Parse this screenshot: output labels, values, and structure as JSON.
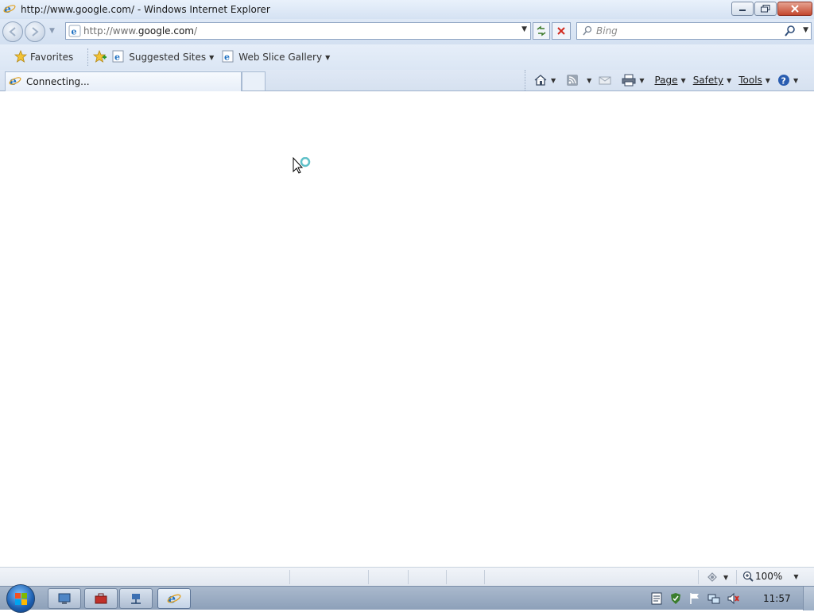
{
  "window": {
    "title": "http://www.google.com/ - Windows Internet Explorer"
  },
  "address": {
    "url_prefix": "http://www.",
    "url_domain": "google.com",
    "url_suffix": "/"
  },
  "search": {
    "placeholder": "Bing"
  },
  "favorites_bar": {
    "favorites_label": "Favorites",
    "suggested_sites_label": "Suggested Sites",
    "web_slice_gallery_label": "Web Slice Gallery"
  },
  "tabs": [
    {
      "label": "Connecting..."
    }
  ],
  "command_bar": {
    "page_label": "Page",
    "safety_label": "Safety",
    "tools_label": "Tools"
  },
  "status_bar": {
    "zoom": "100%"
  },
  "taskbar": {
    "clock": "11:57"
  },
  "icons": [
    "ie-icon",
    "back-icon",
    "forward-icon",
    "refresh-icon",
    "stop-icon",
    "search-icon",
    "favorites-star-icon",
    "add-favorites-icon",
    "home-icon",
    "feeds-icon",
    "mail-icon",
    "print-icon",
    "help-icon",
    "zoom-icon",
    "busy-cursor-icon",
    "windows-orb-icon"
  ],
  "colors": {
    "chrome_blue": "#d5e2f3",
    "close_red": "#c4482f",
    "ie_blue": "#1c6fc1"
  }
}
